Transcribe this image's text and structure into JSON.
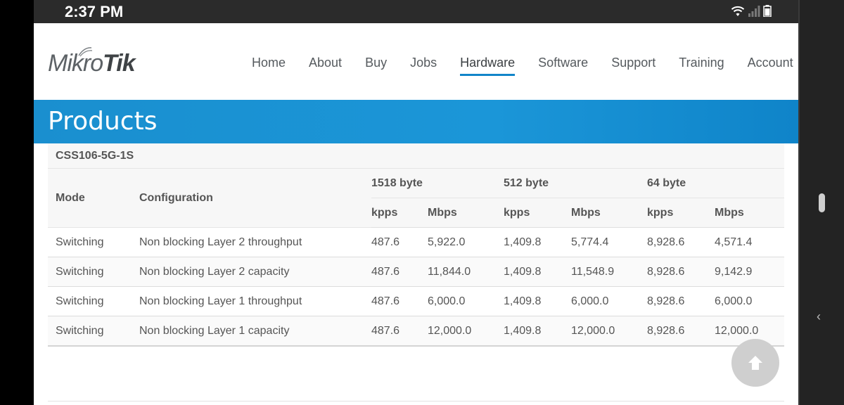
{
  "status_bar": {
    "time": "2:37 PM"
  },
  "brand": {
    "logo_part1": "Mikro",
    "logo_part2": "Tik",
    "accent_color": "#1b96d8"
  },
  "nav": {
    "items": [
      {
        "label": "Home"
      },
      {
        "label": "About"
      },
      {
        "label": "Buy"
      },
      {
        "label": "Jobs"
      },
      {
        "label": "Hardware",
        "active": true
      },
      {
        "label": "Software"
      },
      {
        "label": "Support"
      },
      {
        "label": "Training"
      },
      {
        "label": "Account"
      }
    ]
  },
  "banner": {
    "title": "Products"
  },
  "table": {
    "model": "CSS106-5G-1S",
    "headers": {
      "mode": "Mode",
      "configuration": "Configuration",
      "groups": [
        "1518 byte",
        "512 byte",
        "64 byte"
      ],
      "sub": [
        "kpps",
        "Mbps",
        "kpps",
        "Mbps",
        "kpps",
        "Mbps"
      ]
    },
    "rows": [
      [
        "Switching",
        "Non blocking Layer 2 throughput",
        "487.6",
        "5,922.0",
        "1,409.8",
        "5,774.4",
        "8,928.6",
        "4,571.4"
      ],
      [
        "Switching",
        "Non blocking Layer 2 capacity",
        "487.6",
        "11,844.0",
        "1,409.8",
        "11,548.9",
        "8,928.6",
        "9,142.9"
      ],
      [
        "Switching",
        "Non blocking Layer 1 throughput",
        "487.6",
        "6,000.0",
        "1,409.8",
        "6,000.0",
        "8,928.6",
        "6,000.0"
      ],
      [
        "Switching",
        "Non blocking Layer 1 capacity",
        "487.6",
        "12,000.0",
        "1,409.8",
        "12,000.0",
        "8,928.6",
        "12,000.0"
      ]
    ]
  },
  "icons": {
    "scroll_top": "arrow-up-icon",
    "wifi": "wifi-icon",
    "signal": "signal-icon",
    "battery": "battery-icon",
    "back": "chevron-left-icon"
  }
}
